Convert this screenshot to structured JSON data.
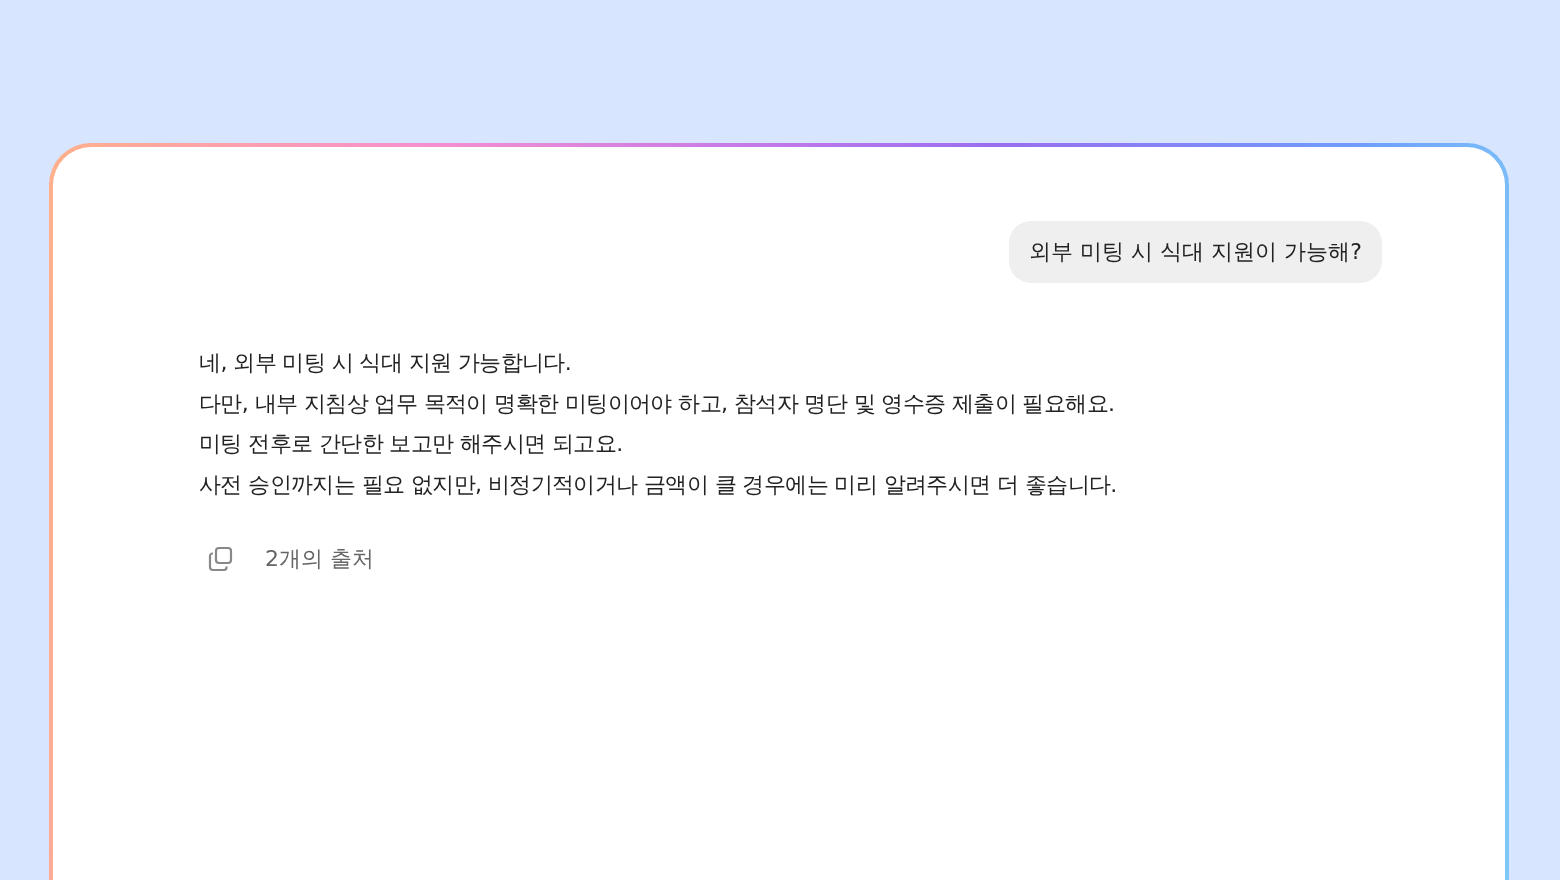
{
  "user_message": "외부 미팅 시 식대 지원이 가능해?",
  "answer": {
    "lines": [
      "네, 외부 미팅 시 식대 지원 가능합니다.",
      "다만, 내부 지침상 업무 목적이 명확한 미팅이어야 하고, 참석자 명단 및 영수증 제출이 필요해요.",
      "미팅 전후로 간단한 보고만 해주시면 되고요.",
      "사전 승인까지는 필요 없지만, 비정기적이거나 금액이 클 경우에는 미리 알려주시면 더 좋습니다."
    ]
  },
  "sources_label": "2개의 출처"
}
